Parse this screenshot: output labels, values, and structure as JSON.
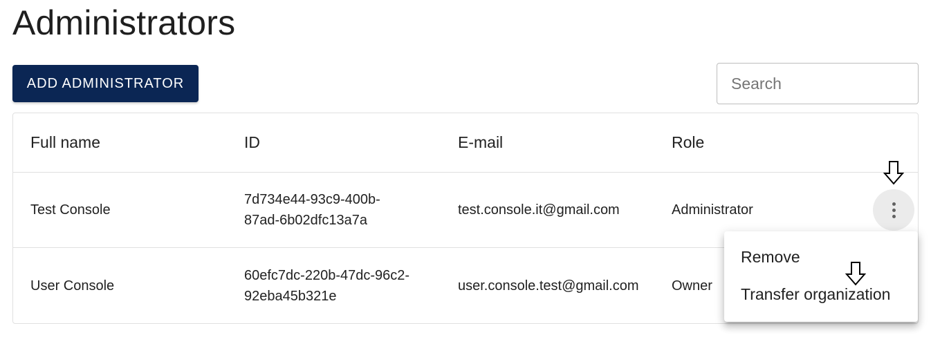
{
  "page": {
    "title": "Administrators"
  },
  "toolbar": {
    "add_button_label": "ADD ADMINISTRATOR",
    "search_placeholder": "Search",
    "search_value": ""
  },
  "table": {
    "columns": [
      "Full name",
      "ID",
      "E-mail",
      "Role"
    ],
    "rows": [
      {
        "full_name": "Test Console",
        "id": "7d734e44-93c9-400b-\n87ad-6b02dfc13a7a",
        "email": "test.console.it@gmail.com",
        "role": "Administrator"
      },
      {
        "full_name": "User Console",
        "id": "60efc7dc-220b-47dc-96c2-\n92eba45b321e",
        "email": "user.console.test@gmail.com",
        "role": "Owner"
      }
    ]
  },
  "row_menu": {
    "items": [
      "Remove",
      "Transfer organization"
    ]
  },
  "colors": {
    "primary_button": "#0b2654",
    "kebab_hover": "#ebebeb",
    "border": "#e0e0e0"
  },
  "icons": {
    "row_actions": "more-vert-icon",
    "cursor": "arrow-down-cursor-icon"
  }
}
